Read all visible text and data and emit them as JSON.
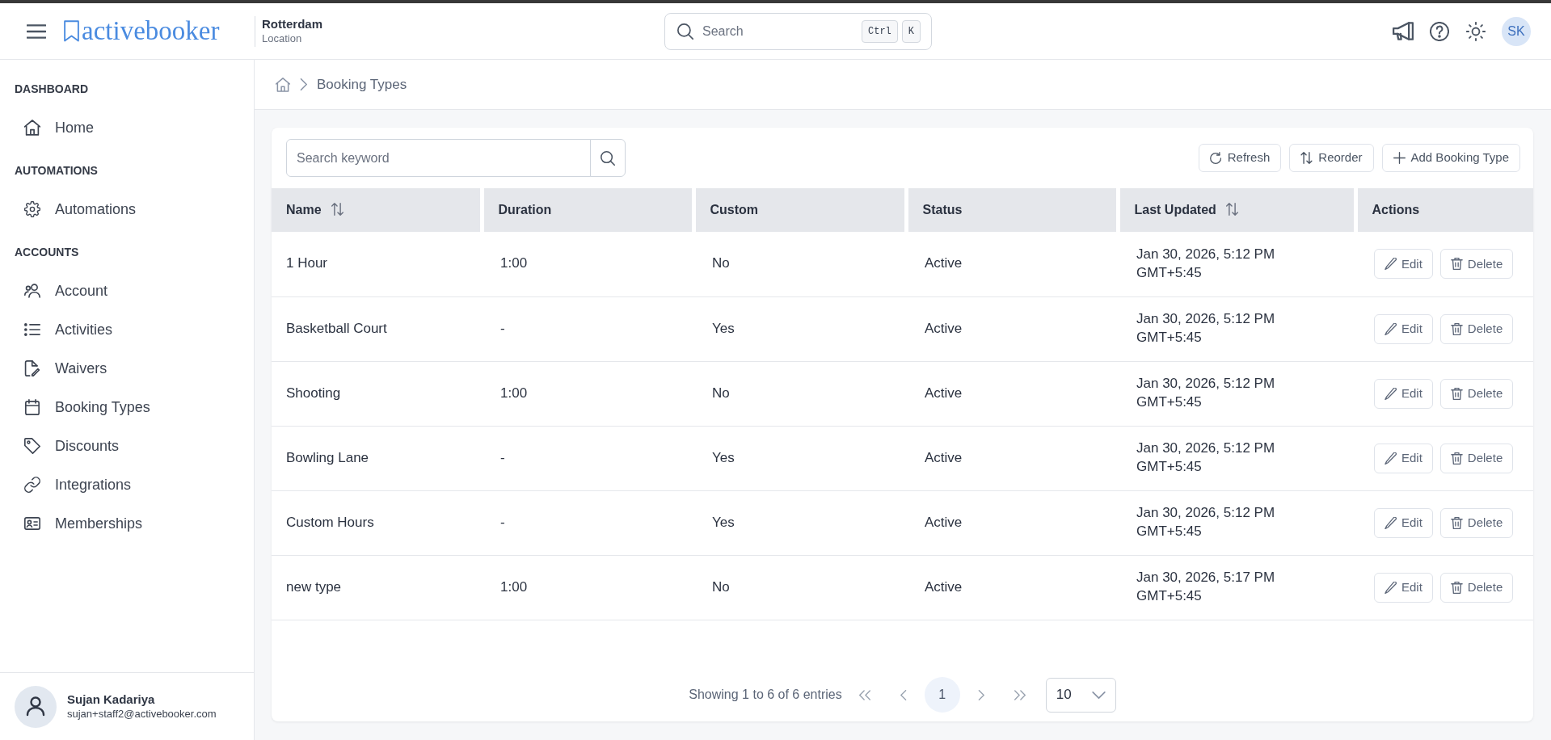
{
  "header": {
    "logo": "activebooker",
    "location": {
      "name": "Rotterdam",
      "label": "Location"
    },
    "search": {
      "placeholder": "Search",
      "shortcut": [
        "Ctrl",
        "K"
      ]
    },
    "avatar": "SK"
  },
  "sidebar": {
    "sections": [
      {
        "title": "DASHBOARD",
        "items": [
          {
            "label": "Home",
            "selected": false
          }
        ]
      },
      {
        "title": "AUTOMATIONS",
        "items": [
          {
            "label": "Automations",
            "selected": false
          }
        ]
      },
      {
        "title": "ACCOUNTS",
        "items": [
          {
            "label": "Account",
            "selected": false
          },
          {
            "label": "Activities",
            "selected": false
          },
          {
            "label": "Waivers",
            "selected": false
          },
          {
            "label": "Booking Types",
            "selected": false
          },
          {
            "label": "Discounts",
            "selected": false
          },
          {
            "label": "Integrations",
            "selected": false
          },
          {
            "label": "Memberships",
            "selected": false
          }
        ]
      }
    ],
    "user": {
      "name": "Sujan Kadariya",
      "email": "sujan+staff2@activebooker.com"
    }
  },
  "breadcrumb": {
    "current": "Booking Types"
  },
  "toolbar": {
    "search": {
      "placeholder": "Search keyword"
    },
    "buttons": [
      "Refresh",
      "Reorder",
      "Add Booking Type"
    ]
  },
  "table": {
    "columns": [
      {
        "label": "Name",
        "sortable": true
      },
      {
        "label": "Duration",
        "sortable": false
      },
      {
        "label": "Custom",
        "sortable": false
      },
      {
        "label": "Status",
        "sortable": false
      },
      {
        "label": "Last Updated",
        "sortable": true
      },
      {
        "label": "Actions",
        "sortable": false
      }
    ],
    "rows": [
      {
        "name": "1 Hour",
        "duration": "1:00",
        "custom": "No",
        "status": "Active",
        "last_updated": "Jan 30, 2026, 5:12 PM GMT+5:45",
        "actions": [
          "Edit",
          "Delete"
        ]
      },
      {
        "name": "Basketball Court",
        "duration": "-",
        "custom": "Yes",
        "status": "Active",
        "last_updated": "Jan 30, 2026, 5:12 PM GMT+5:45",
        "actions": [
          "Edit",
          "Delete"
        ]
      },
      {
        "name": "Shooting",
        "duration": "1:00",
        "custom": "No",
        "status": "Active",
        "last_updated": "Jan 30, 2026, 5:12 PM GMT+5:45",
        "actions": [
          "Edit",
          "Delete"
        ]
      },
      {
        "name": "Bowling Lane",
        "duration": "-",
        "custom": "Yes",
        "status": "Active",
        "last_updated": "Jan 30, 2026, 5:12 PM GMT+5:45",
        "actions": [
          "Edit",
          "Delete"
        ]
      },
      {
        "name": "Custom Hours",
        "duration": "-",
        "custom": "Yes",
        "status": "Active",
        "last_updated": "Jan 30, 2026, 5:12 PM GMT+5:45",
        "actions": [
          "Edit",
          "Delete"
        ]
      },
      {
        "name": "new type",
        "duration": "1:00",
        "custom": "No",
        "status": "Active",
        "last_updated": "Jan 30, 2026, 5:17 PM GMT+5:45",
        "actions": [
          "Edit",
          "Delete"
        ]
      }
    ]
  },
  "pagination": {
    "summary": "Showing 1 to 6 of 6 entries",
    "pages": [
      {
        "label": "1",
        "selected": true
      }
    ],
    "page_size": "10"
  }
}
